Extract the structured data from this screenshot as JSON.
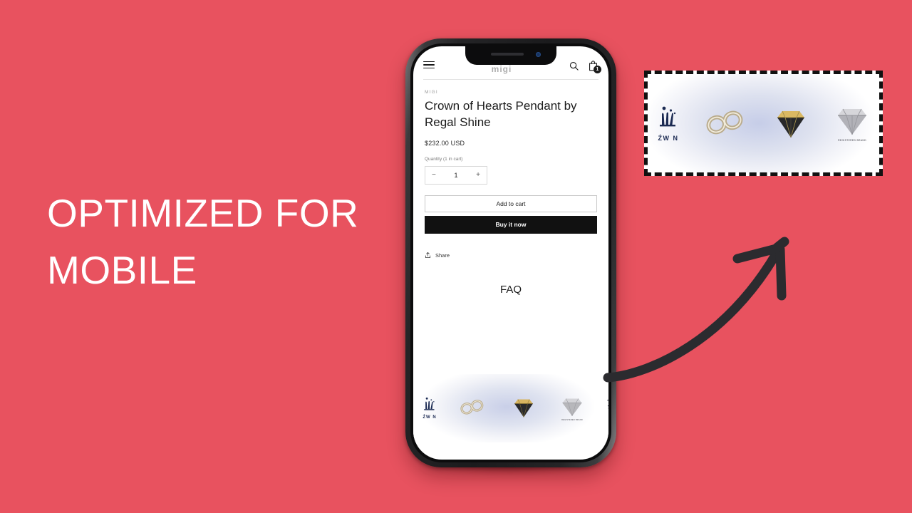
{
  "page": {
    "background_color": "#e8525f",
    "headline_lines": [
      "OPTIMIZED FOR",
      "MOBILE"
    ],
    "headline_color": "#ffffff"
  },
  "phone": {
    "frame_color": "#1b1b1d",
    "screen_background": "#ffffff"
  },
  "store_header": {
    "menu_icon": "hamburger-icon",
    "logo_text": "migi",
    "search_icon": "search-icon",
    "cart_icon": "shopping-bag-icon",
    "cart_count": "1"
  },
  "product": {
    "vendor": "MIGI",
    "title": "Crown of Hearts Pendant by Regal Shine",
    "price": "$232.00 USD",
    "quantity_label": "Quantity (1 in cart)",
    "quantity_value": "1",
    "decrement_label": "−",
    "increment_label": "+",
    "add_to_cart_label": "Add to cart",
    "buy_now_label": "Buy it now",
    "buy_now_bg": "#111111",
    "share_label": "Share",
    "share_icon": "share-icon",
    "faq_heading": "FAQ"
  },
  "trust_badges": {
    "glow_color": "#c9cfe8",
    "items": [
      {
        "icon": "crown-logo-icon",
        "caption": "",
        "sub": "ŹW N"
      },
      {
        "icon": "infinity-ring-icon",
        "caption": "",
        "sub": ""
      },
      {
        "icon": "gold-diamond-icon",
        "caption": "",
        "sub": ""
      },
      {
        "icon": "silver-diamond-icon",
        "caption": "REGISTERED BRAND",
        "sub": ""
      },
      {
        "icon": "partial-script-logo-icon",
        "caption": "Pa",
        "sub": ""
      }
    ]
  },
  "callout": {
    "border_style": "dashed",
    "border_color": "#111111",
    "description": "magnified-trust-badge-strip"
  },
  "arrow": {
    "icon": "curved-arrow-icon",
    "color": "#2b2b2f",
    "direction": "up-right"
  }
}
